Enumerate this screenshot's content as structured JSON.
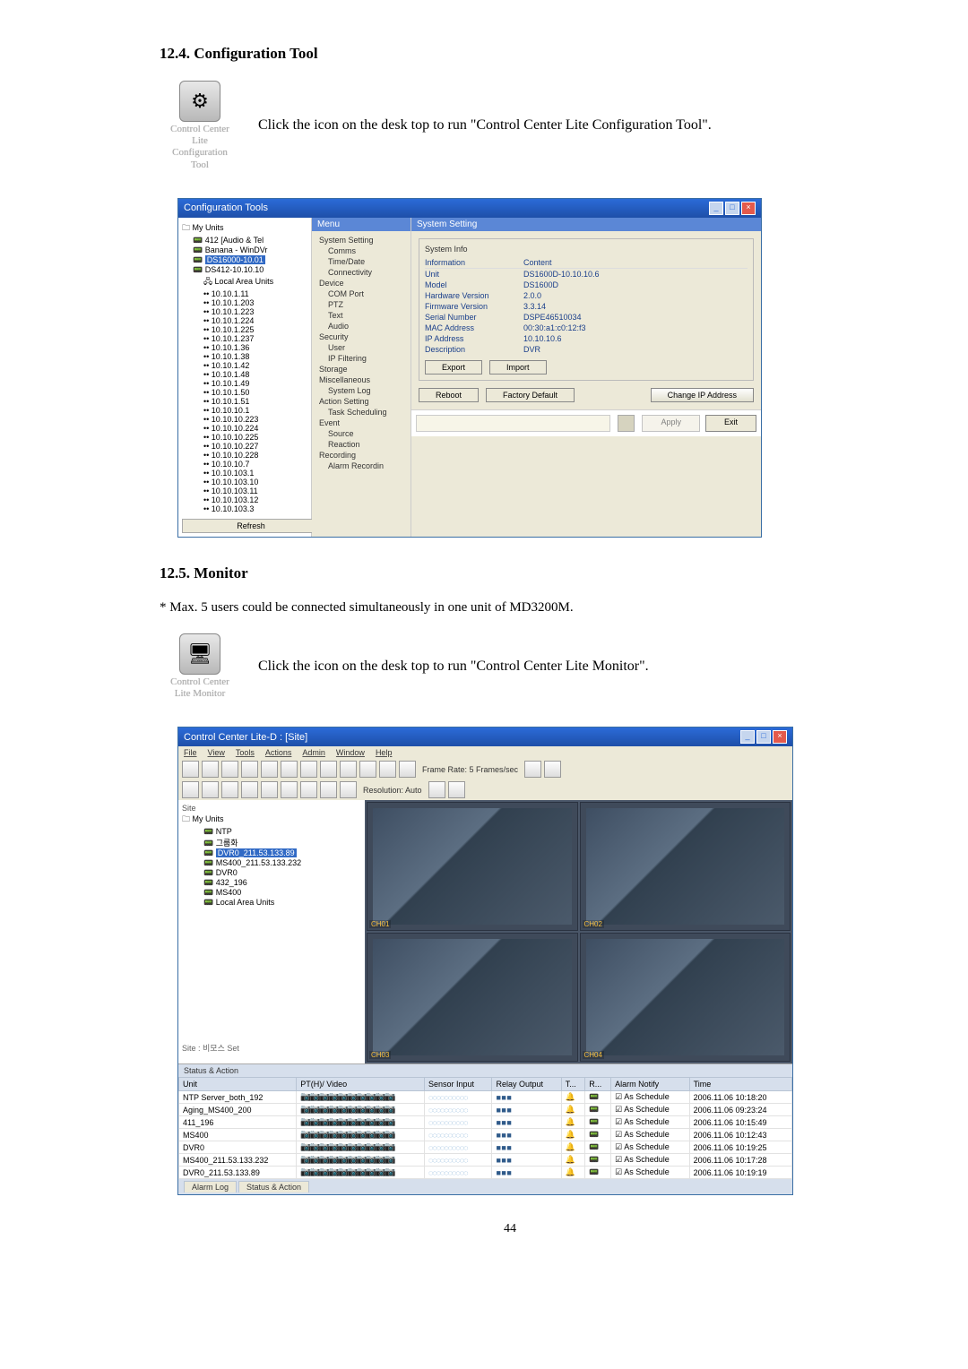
{
  "section1": {
    "heading": "12.4. Configuration Tool"
  },
  "icon1": {
    "label_l1": "Control Center",
    "label_l2": "Lite",
    "label_l3": "Configuration",
    "label_l4": "Tool",
    "glyph": "⚙",
    "desc": "Click the icon on the desk top to run \"Control Center Lite Configuration Tool\"."
  },
  "cfg": {
    "title": "Configuration Tools",
    "tree_root": "My Units",
    "tree_items": [
      "412 [Audio & Tel",
      "Banana - WinDVr",
      "DS16000-10.01",
      "DS412-10.10.10",
      "Local Area Units",
      "10.10.1.11",
      "10.10.1.203",
      "10.10.1.223",
      "10.10.1.224",
      "10.10.1.225",
      "10.10.1.237",
      "10.10.1.36",
      "10.10.1.38",
      "10.10.1.42",
      "10.10.1.48",
      "10.10.1.49",
      "10.10.1.50",
      "10.10.1.51",
      "10.10.10.1",
      "10.10.10.223",
      "10.10.10.224",
      "10.10.10.225",
      "10.10.10.227",
      "10.10.10.228",
      "10.10.10.7",
      "10.10.103.1",
      "10.10.103.10",
      "10.10.103.11",
      "10.10.103.12",
      "10.10.103.3"
    ],
    "refresh": "Refresh",
    "menu_title": "Menu",
    "menu_items": [
      "System Setting",
      "  Comms",
      "  Time/Date",
      "  Connectivity",
      "Device",
      "  COM Port",
      "  PTZ",
      "  Text",
      "  Audio",
      "Security",
      "  User",
      "  IP Filtering",
      "Storage",
      "Miscellaneous",
      "  System Log",
      "Action Setting",
      "  Task Scheduling",
      "Event",
      "  Source",
      "  Reaction",
      "Recording",
      "  Alarm Recordin"
    ],
    "main_title": "System Setting",
    "info_title": "System Info",
    "info_cols": {
      "a": "Information",
      "b": "Content"
    },
    "info_rows": [
      {
        "lbl": "Unit",
        "val": "DS1600D-10.10.10.6"
      },
      {
        "lbl": "Model",
        "val": "DS1600D"
      },
      {
        "lbl": "Hardware Version",
        "val": "2.0.0"
      },
      {
        "lbl": "Firmware Version",
        "val": "3.3.14"
      },
      {
        "lbl": "Serial Number",
        "val": "DSPE46510034"
      },
      {
        "lbl": "MAC Address",
        "val": "00:30:a1:c0:12:f3"
      },
      {
        "lbl": "IP Address",
        "val": "10.10.10.6"
      },
      {
        "lbl": "Description",
        "val": "DVR"
      }
    ],
    "btn_export": "Export",
    "btn_import": "Import",
    "btn_reboot": "Reboot",
    "btn_factory": "Factory Default",
    "btn_changeip": "Change IP Address",
    "btn_apply": "Apply",
    "btn_exit": "Exit"
  },
  "section2": {
    "heading": "12.5. Monitor",
    "foot": "* Max. 5 users could be connected simultaneously in one unit of MD3200M."
  },
  "icon2": {
    "label_l1": "Control Center",
    "label_l2": "Lite Monitor",
    "glyph": "🖥",
    "desc": "Click the icon on the desk top to run \"Control Center Lite Monitor\"."
  },
  "mon": {
    "title": "Control Center Lite-D : [Site]",
    "menu": [
      "File",
      "View",
      "Tools",
      "Actions",
      "Admin",
      "Window",
      "Help"
    ],
    "tb_frame": "Frame Rate: 5 Frames/sec",
    "tb_res": "Resolution: Auto",
    "tree_root": "My Units",
    "tree_items": [
      "NTP",
      "그룹화",
      "DVR0_211.53.133.89",
      "MS400_211.53.133.232",
      "DVR0",
      "432_196",
      "MS400",
      "Local Area Units"
    ],
    "sitebar": "Site : 비모스 Set",
    "status_hdr": "Status & Action",
    "cols": [
      "Unit",
      "PT(H)/ Video",
      "Sensor Input",
      "Relay Output",
      "T...",
      "R...",
      "Alarm Notify",
      "Time"
    ],
    "rows": [
      {
        "u": "NTP Server_both_192",
        "n": "As Schedule",
        "t": "2006.11.06 10:18:20"
      },
      {
        "u": "Aging_MS400_200",
        "n": "As Schedule",
        "t": "2006.11.06 09:23:24"
      },
      {
        "u": "411_196",
        "n": "As Schedule",
        "t": "2006.11.06 10:15:49"
      },
      {
        "u": "MS400",
        "n": "As Schedule",
        "t": "2006.11.06 10:12:43"
      },
      {
        "u": "DVR0",
        "n": "As Schedule",
        "t": "2006.11.06 10:19:25"
      },
      {
        "u": "MS400_211.53.133.232",
        "n": "As Schedule",
        "t": "2006.11.06 10:17:28"
      },
      {
        "u": "DVR0_211.53.133.89",
        "n": "As Schedule",
        "t": "2006.11.06 10:19:19"
      }
    ],
    "tabs": [
      "Alarm Log",
      "Status & Action"
    ]
  },
  "pagenum": "44"
}
